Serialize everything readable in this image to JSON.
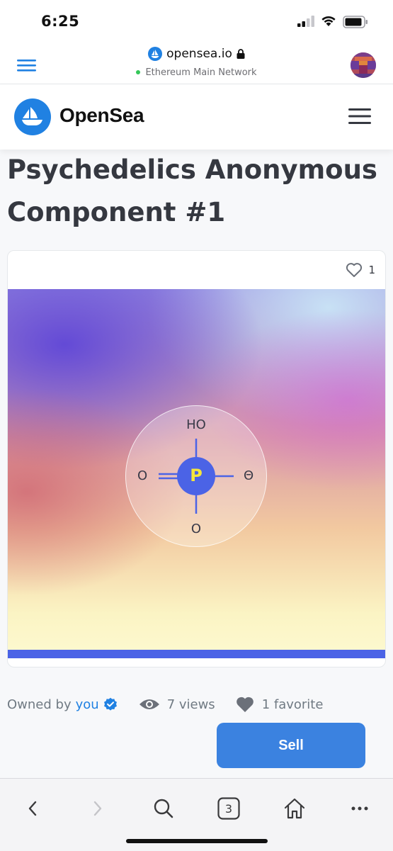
{
  "status_bar": {
    "time": "6:25"
  },
  "browser": {
    "domain": "opensea.io",
    "network": "Ethereum Main Network"
  },
  "header": {
    "brand": "OpenSea"
  },
  "asset": {
    "title": "Psychedelics Anonymous Component #1",
    "favorites_count": "1",
    "art_labels": {
      "top": "HO",
      "left": "O",
      "right": "Θ",
      "bottom": "O",
      "center": "P"
    }
  },
  "details": {
    "owned_by_label": "Owned by",
    "owner": "you",
    "views": "7 views",
    "favorites": "1 favorite"
  },
  "actions": {
    "sell_label": "Sell"
  },
  "toolbar": {
    "tab_count": "3"
  },
  "colors": {
    "accent": "#2081e2",
    "sell_button": "#3b82e0",
    "art_center": "#4b63e6",
    "art_center_letter": "#f5e53c"
  }
}
